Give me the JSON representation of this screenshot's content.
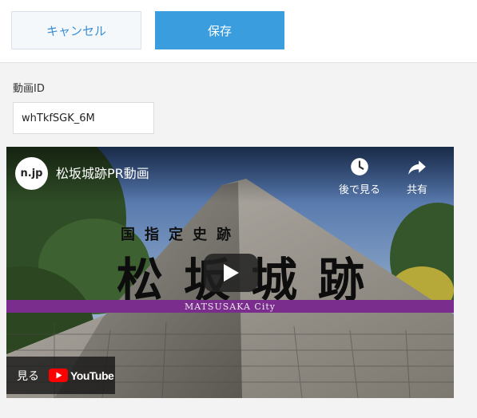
{
  "toolbar": {
    "cancel_label": "キャンセル",
    "save_label": "保存"
  },
  "form": {
    "video_id_label": "動画ID",
    "video_id_value": "whTkfSGK_6M"
  },
  "video": {
    "channel_logo_text": "n.jp",
    "title": "松坂城跡PR動画",
    "watch_later_label": "後で見る",
    "share_label": "共有",
    "thumbnail_heading_small": "国指定史跡",
    "thumbnail_heading_large": "松坂城跡",
    "thumbnail_banner": "MATSUSAKA City",
    "watch_on_label": "見る",
    "youtube_wordmark": "YouTube",
    "icons": [
      "clock-icon",
      "share-arrow-icon",
      "play-icon",
      "youtube-logo-icon"
    ]
  },
  "colors": {
    "primary": "#3a9ede",
    "cancel_text": "#3a8fd6",
    "banner": "#7a2d8c",
    "youtube_red": "#ff0000"
  }
}
